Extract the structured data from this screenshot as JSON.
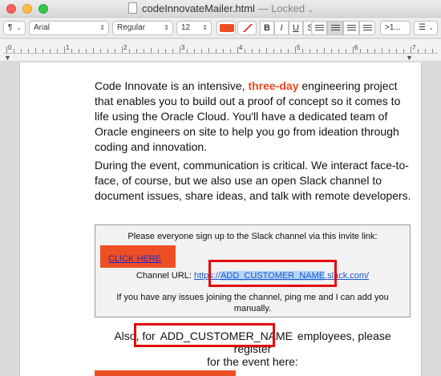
{
  "window": {
    "title": "codeInnovateMailer.html",
    "status": "— Locked"
  },
  "toolbar": {
    "paragraph_style": "¶",
    "font_family": "Arial",
    "font_style": "Regular",
    "font_size": "12",
    "bold": "B",
    "italic": "I",
    "underline": "U",
    "strikethrough": "S",
    "text_color": "#ee4e23",
    "line_spacing": ">1..."
  },
  "ruler": {
    "numbers": [
      "0",
      "1",
      "2",
      "3",
      "4",
      "5",
      "6",
      "7"
    ]
  },
  "document": {
    "para1": {
      "before": "Code Innovate is an intensive, ",
      "highlight": "three-day",
      "after": " engineering project that enables you to build out a proof of concept so it comes to life using the Oracle Cloud. You'll have a dedicated team of Oracle engineers on site to help you go from ideation through coding and innovation."
    },
    "para2": "During the event, communication is critical. We interact face-to-face, of course, but we also use an open Slack channel to document issues, share ideas, and talk with remote developers.",
    "slack_box": {
      "intro": "Please everyone sign up to the Slack channel via this invite link:",
      "click_here": "CLICK HERE",
      "channel_label": "Channel URL: ",
      "url_prefix": "https://",
      "url_placeholder": "ADD_CUSTOMER_NAME",
      "url_suffix": ".slack.com/",
      "issues_line1": "If you have any issues joining the channel, ping me and I can add you",
      "issues_line2": "manually."
    },
    "also": {
      "before": "Also, for ",
      "placeholder": "ADD_CUSTOMER_NAME",
      "after": " employees, please register",
      "line2": "for the event here:"
    }
  },
  "colors": {
    "accent": "#ee4e23",
    "highlight_border": "#e30b0b",
    "link": "#1a55cc"
  }
}
